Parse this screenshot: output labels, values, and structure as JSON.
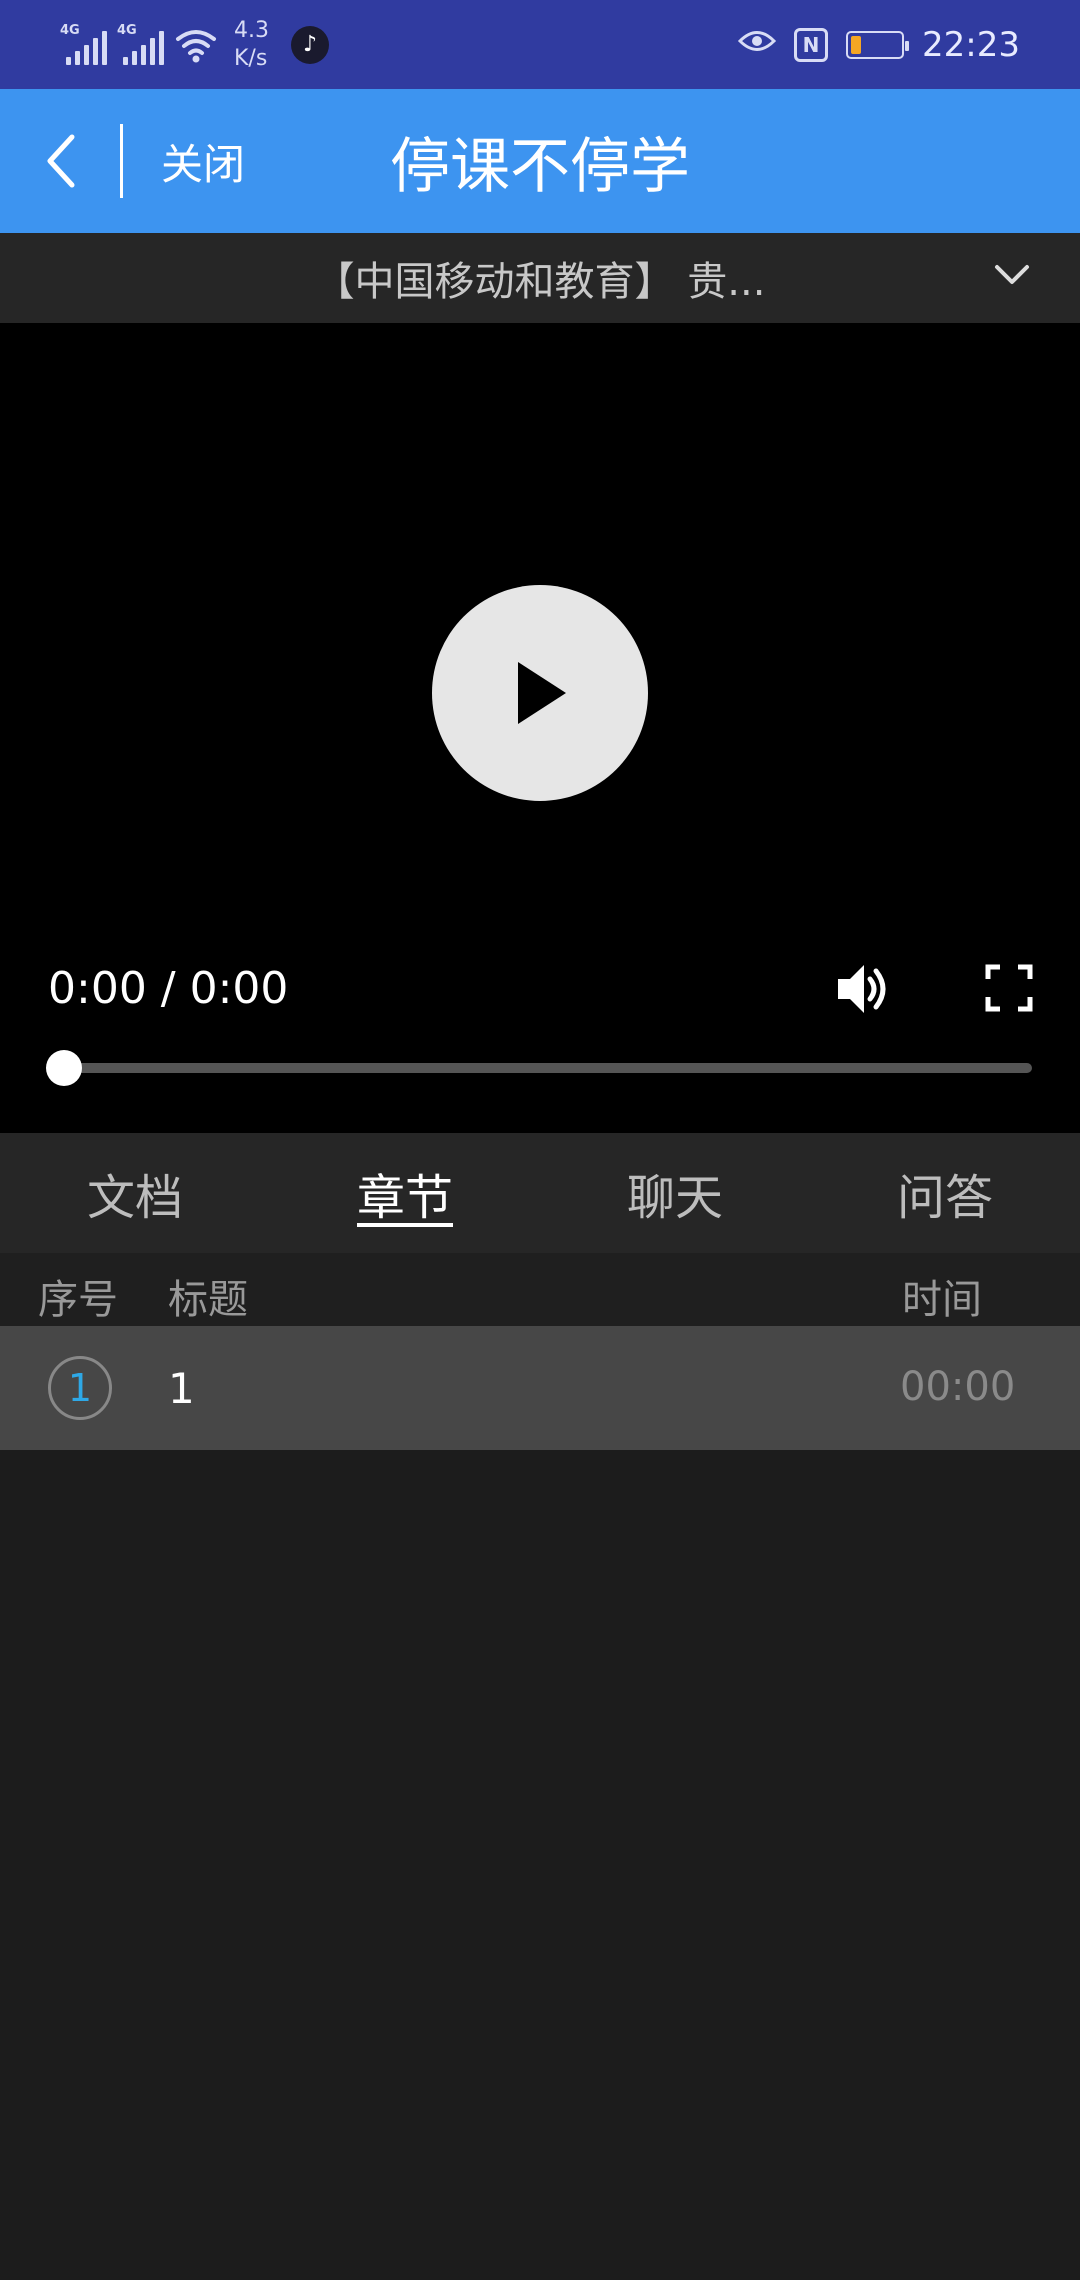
{
  "status_bar": {
    "signal1_label": "4G",
    "signal2_label": "4G",
    "speed_value": "4.3",
    "speed_unit": "K/s",
    "nfc_label": "N",
    "battery_level": 0.2,
    "time": "22:23"
  },
  "header": {
    "close_label": "关闭",
    "title": "停课不停学"
  },
  "course": {
    "title": "【中国移动和教育】 贵..."
  },
  "player": {
    "time_display": "0:00 / 0:00",
    "progress": 0
  },
  "tabs": [
    {
      "label": "文档",
      "active": false
    },
    {
      "label": "章节",
      "active": true
    },
    {
      "label": "聊天",
      "active": false
    },
    {
      "label": "问答",
      "active": false
    }
  ],
  "chapters": {
    "headers": {
      "index": "序号",
      "title": "标题",
      "time": "时间"
    },
    "rows": [
      {
        "index": "1",
        "title": "1",
        "time": "00:00"
      }
    ]
  },
  "colors": {
    "status_bar_bg": "#303ba0",
    "header_bg": "#3d94f0",
    "accent_index": "#2ea8e6"
  }
}
